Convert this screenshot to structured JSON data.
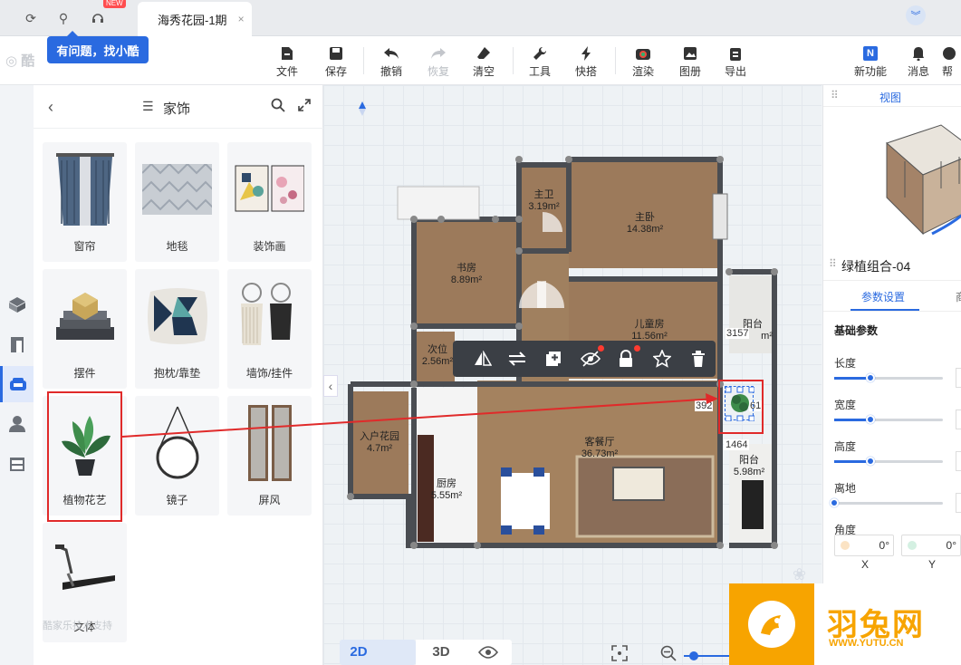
{
  "tabbar": {
    "new_badge": "NEW",
    "doc_title": "海秀花园-1期",
    "close": "×"
  },
  "toolbar": {
    "items": [
      {
        "label": "文件"
      },
      {
        "label": "保存"
      },
      {
        "label": "撤销"
      },
      {
        "label": "恢复"
      },
      {
        "label": "清空"
      },
      {
        "label": "工具"
      },
      {
        "label": "快搭"
      },
      {
        "label": "渲染"
      },
      {
        "label": "图册"
      },
      {
        "label": "导出"
      },
      {
        "label": "新功能"
      },
      {
        "label": "消息"
      },
      {
        "label": "帮"
      }
    ]
  },
  "logo": "酷",
  "tooltip": "有问题，找小酷",
  "panel": {
    "title": "家饰",
    "items": [
      {
        "label": "窗帘"
      },
      {
        "label": "地毯"
      },
      {
        "label": "装饰画"
      },
      {
        "label": "摆件"
      },
      {
        "label": "抱枕/靠垫"
      },
      {
        "label": "墙饰/挂件"
      },
      {
        "label": "植物花艺"
      },
      {
        "label": "镜子"
      },
      {
        "label": "屏风"
      },
      {
        "label": "文体"
      }
    ],
    "footer": "酷家乐技术支持"
  },
  "plan": {
    "rooms": [
      {
        "name": "主卫",
        "area": "3.19m²"
      },
      {
        "name": "主卧",
        "area": "14.38m²"
      },
      {
        "name": "书房",
        "area": "8.89m²"
      },
      {
        "name": "儿童房",
        "area": "11.56m²"
      },
      {
        "name": "次位",
        "area": "2.56m²"
      },
      {
        "name": "阳台",
        "area": "m²"
      },
      {
        "name": "入户花园",
        "area": "4.7m²"
      },
      {
        "name": "厨房",
        "area": "5.55m²"
      },
      {
        "name": "客餐厅",
        "area": "36.73m²"
      },
      {
        "name": "阳台",
        "area": "5.98m²"
      }
    ],
    "dims": [
      "3157",
      "1464",
      "392",
      "61"
    ]
  },
  "view": {
    "mode_2d": "2D",
    "mode_3d": "3D"
  },
  "right": {
    "view_title": "视图",
    "object_name": "绿植组合-04",
    "tab_params": "参数设置",
    "tab_other": "商",
    "section": "基础参数",
    "params": [
      {
        "label": "长度",
        "level": 0.33
      },
      {
        "label": "宽度",
        "level": 0.33
      },
      {
        "label": "高度",
        "level": 0.33
      },
      {
        "label": "离地",
        "level": 0.0
      }
    ],
    "angle_label": "角度",
    "angle_x": "0°",
    "angle_y": "0°",
    "axis_x": "X",
    "axis_y": "Y"
  },
  "watermark": {
    "name": "羽兔网",
    "url": "WWW.YUTU.CN"
  },
  "colors": {
    "accent": "#2a6ae0",
    "highlight": "#e02a2a",
    "wall": "#4a4d52",
    "floor": "#9c7a5b"
  }
}
